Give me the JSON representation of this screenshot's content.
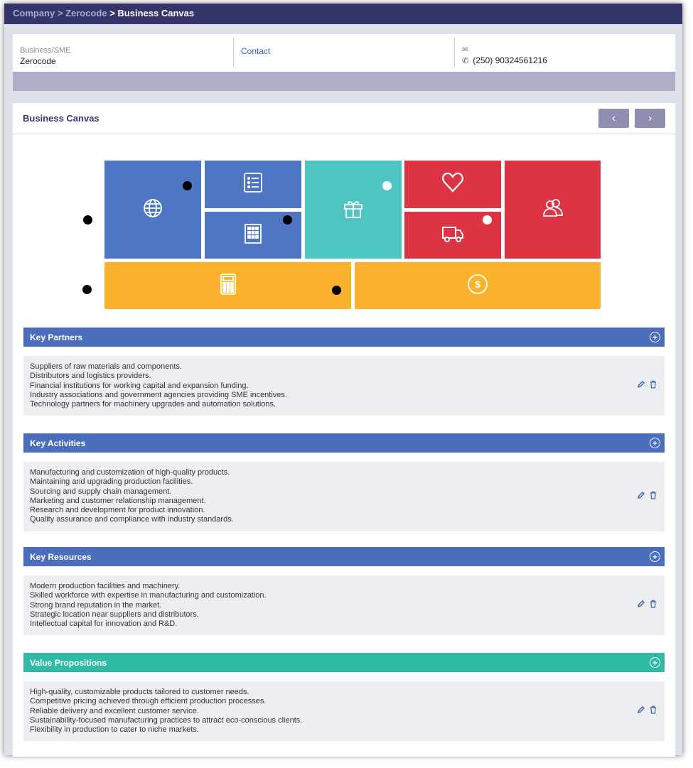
{
  "breadcrumb": {
    "company": "Company",
    "sep1": ">",
    "zerocode": "Zerocode",
    "current": "> Business Canvas"
  },
  "info": {
    "business_label": "Business/SME",
    "business_value": "Zerocode",
    "contact_label": "Contact",
    "phone": "(250) 90324561216"
  },
  "panel": {
    "title": "Business Canvas",
    "prev": "‹",
    "next": "›"
  },
  "colors": {
    "blue": "#4e76c4",
    "teal": "#4ec5c1",
    "red": "#dd3444",
    "gold": "#fbb22c",
    "nav": "#35346b"
  },
  "canvas_icons": [
    "globe-icon",
    "list-icon",
    "building-icon",
    "gift-icon",
    "heart-icon",
    "truck-icon",
    "users-icon",
    "calculator-icon",
    "dollar-icon"
  ],
  "sections": [
    {
      "title": "Key Partners",
      "lines": [
        "Suppliers of raw materials and components.",
        "Distributors and logistics providers.",
        "Financial institutions for working capital and expansion funding.",
        "Industry associations and government agencies providing SME incentives.",
        "Technology partners for machinery upgrades and automation solutions."
      ]
    },
    {
      "title": "Key Activities",
      "lines": [
        "Manufacturing and customization of high-quality products.",
        "Maintaining and upgrading production facilities.",
        "Sourcing and supply chain management.",
        "Marketing and customer relationship management.",
        "Research and development for product innovation.",
        "Quality assurance and compliance with industry standards."
      ]
    },
    {
      "title": "Key Resources",
      "lines": [
        "Modern production facilities and machinery.",
        "Skilled workforce with expertise in manufacturing and customization.",
        "Strong brand reputation in the market.",
        "Strategic location near suppliers and distributors.",
        "Intellectual capital for innovation and R&D."
      ]
    },
    {
      "title": "Value Propositions",
      "lines": [
        "High-quality, customizable products tailored to customer needs.",
        "Competitive pricing achieved through efficient production processes.",
        "Reliable delivery and excellent customer service.",
        "Sustainability-focused manufacturing practices to attract eco-conscious clients.",
        "Flexibility in production to cater to niche markets."
      ]
    }
  ]
}
